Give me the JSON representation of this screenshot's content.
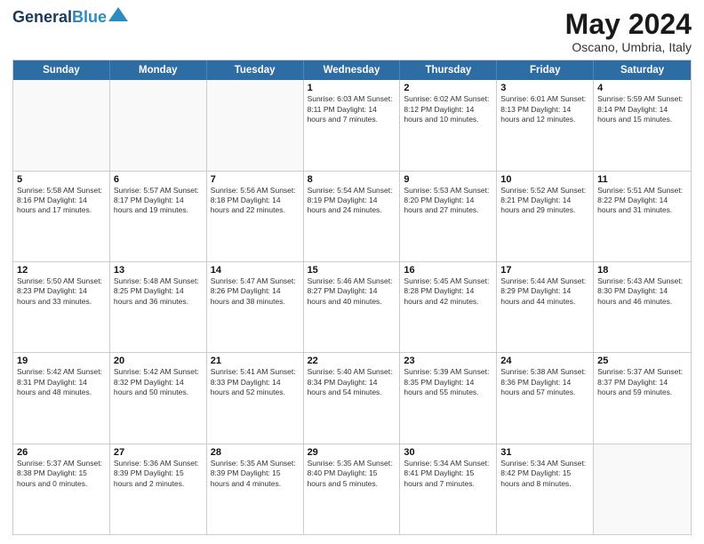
{
  "header": {
    "logo_line1": "General",
    "logo_line2": "Blue",
    "month": "May 2024",
    "location": "Oscano, Umbria, Italy"
  },
  "weekdays": [
    "Sunday",
    "Monday",
    "Tuesday",
    "Wednesday",
    "Thursday",
    "Friday",
    "Saturday"
  ],
  "rows": [
    [
      {
        "day": "",
        "info": ""
      },
      {
        "day": "",
        "info": ""
      },
      {
        "day": "",
        "info": ""
      },
      {
        "day": "1",
        "info": "Sunrise: 6:03 AM\nSunset: 8:11 PM\nDaylight: 14 hours\nand 7 minutes."
      },
      {
        "day": "2",
        "info": "Sunrise: 6:02 AM\nSunset: 8:12 PM\nDaylight: 14 hours\nand 10 minutes."
      },
      {
        "day": "3",
        "info": "Sunrise: 6:01 AM\nSunset: 8:13 PM\nDaylight: 14 hours\nand 12 minutes."
      },
      {
        "day": "4",
        "info": "Sunrise: 5:59 AM\nSunset: 8:14 PM\nDaylight: 14 hours\nand 15 minutes."
      }
    ],
    [
      {
        "day": "5",
        "info": "Sunrise: 5:58 AM\nSunset: 8:16 PM\nDaylight: 14 hours\nand 17 minutes."
      },
      {
        "day": "6",
        "info": "Sunrise: 5:57 AM\nSunset: 8:17 PM\nDaylight: 14 hours\nand 19 minutes."
      },
      {
        "day": "7",
        "info": "Sunrise: 5:56 AM\nSunset: 8:18 PM\nDaylight: 14 hours\nand 22 minutes."
      },
      {
        "day": "8",
        "info": "Sunrise: 5:54 AM\nSunset: 8:19 PM\nDaylight: 14 hours\nand 24 minutes."
      },
      {
        "day": "9",
        "info": "Sunrise: 5:53 AM\nSunset: 8:20 PM\nDaylight: 14 hours\nand 27 minutes."
      },
      {
        "day": "10",
        "info": "Sunrise: 5:52 AM\nSunset: 8:21 PM\nDaylight: 14 hours\nand 29 minutes."
      },
      {
        "day": "11",
        "info": "Sunrise: 5:51 AM\nSunset: 8:22 PM\nDaylight: 14 hours\nand 31 minutes."
      }
    ],
    [
      {
        "day": "12",
        "info": "Sunrise: 5:50 AM\nSunset: 8:23 PM\nDaylight: 14 hours\nand 33 minutes."
      },
      {
        "day": "13",
        "info": "Sunrise: 5:48 AM\nSunset: 8:25 PM\nDaylight: 14 hours\nand 36 minutes."
      },
      {
        "day": "14",
        "info": "Sunrise: 5:47 AM\nSunset: 8:26 PM\nDaylight: 14 hours\nand 38 minutes."
      },
      {
        "day": "15",
        "info": "Sunrise: 5:46 AM\nSunset: 8:27 PM\nDaylight: 14 hours\nand 40 minutes."
      },
      {
        "day": "16",
        "info": "Sunrise: 5:45 AM\nSunset: 8:28 PM\nDaylight: 14 hours\nand 42 minutes."
      },
      {
        "day": "17",
        "info": "Sunrise: 5:44 AM\nSunset: 8:29 PM\nDaylight: 14 hours\nand 44 minutes."
      },
      {
        "day": "18",
        "info": "Sunrise: 5:43 AM\nSunset: 8:30 PM\nDaylight: 14 hours\nand 46 minutes."
      }
    ],
    [
      {
        "day": "19",
        "info": "Sunrise: 5:42 AM\nSunset: 8:31 PM\nDaylight: 14 hours\nand 48 minutes."
      },
      {
        "day": "20",
        "info": "Sunrise: 5:42 AM\nSunset: 8:32 PM\nDaylight: 14 hours\nand 50 minutes."
      },
      {
        "day": "21",
        "info": "Sunrise: 5:41 AM\nSunset: 8:33 PM\nDaylight: 14 hours\nand 52 minutes."
      },
      {
        "day": "22",
        "info": "Sunrise: 5:40 AM\nSunset: 8:34 PM\nDaylight: 14 hours\nand 54 minutes."
      },
      {
        "day": "23",
        "info": "Sunrise: 5:39 AM\nSunset: 8:35 PM\nDaylight: 14 hours\nand 55 minutes."
      },
      {
        "day": "24",
        "info": "Sunrise: 5:38 AM\nSunset: 8:36 PM\nDaylight: 14 hours\nand 57 minutes."
      },
      {
        "day": "25",
        "info": "Sunrise: 5:37 AM\nSunset: 8:37 PM\nDaylight: 14 hours\nand 59 minutes."
      }
    ],
    [
      {
        "day": "26",
        "info": "Sunrise: 5:37 AM\nSunset: 8:38 PM\nDaylight: 15 hours\nand 0 minutes."
      },
      {
        "day": "27",
        "info": "Sunrise: 5:36 AM\nSunset: 8:39 PM\nDaylight: 15 hours\nand 2 minutes."
      },
      {
        "day": "28",
        "info": "Sunrise: 5:35 AM\nSunset: 8:39 PM\nDaylight: 15 hours\nand 4 minutes."
      },
      {
        "day": "29",
        "info": "Sunrise: 5:35 AM\nSunset: 8:40 PM\nDaylight: 15 hours\nand 5 minutes."
      },
      {
        "day": "30",
        "info": "Sunrise: 5:34 AM\nSunset: 8:41 PM\nDaylight: 15 hours\nand 7 minutes."
      },
      {
        "day": "31",
        "info": "Sunrise: 5:34 AM\nSunset: 8:42 PM\nDaylight: 15 hours\nand 8 minutes."
      },
      {
        "day": "",
        "info": ""
      }
    ]
  ]
}
